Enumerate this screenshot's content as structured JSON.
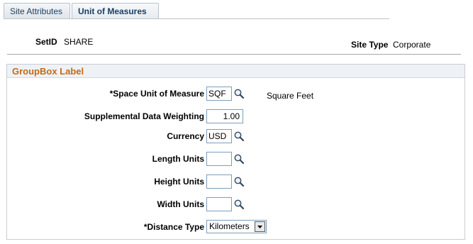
{
  "tabs": [
    {
      "label": "Site Attributes",
      "active": false
    },
    {
      "label": "Unit of Measures",
      "active": true
    }
  ],
  "header": {
    "setid_label": "SetID",
    "setid_value": "SHARE",
    "site_type_label": "Site Type",
    "site_type_value": "Corporate"
  },
  "groupbox": {
    "title": "GroupBox Label",
    "fields": {
      "space_uom": {
        "label": "*Space Unit of Measure",
        "value": "SQF",
        "description": "Square Feet"
      },
      "supp_weight": {
        "label": "Supplemental Data Weighting",
        "value": "1.00"
      },
      "currency": {
        "label": "Currency",
        "value": "USD"
      },
      "length_units": {
        "label": "Length Units",
        "value": ""
      },
      "height_units": {
        "label": "Height Units",
        "value": ""
      },
      "width_units": {
        "label": "Width Units",
        "value": ""
      },
      "distance_type": {
        "label": "*Distance Type",
        "value": "Kilometers"
      }
    }
  },
  "icons": {
    "lookup": "magnifier-icon",
    "dropdown": "chevron-down-icon"
  },
  "colors": {
    "group_title": "#c46a17",
    "tab_text": "#1a3d5c",
    "field_border": "#7f9db9"
  }
}
